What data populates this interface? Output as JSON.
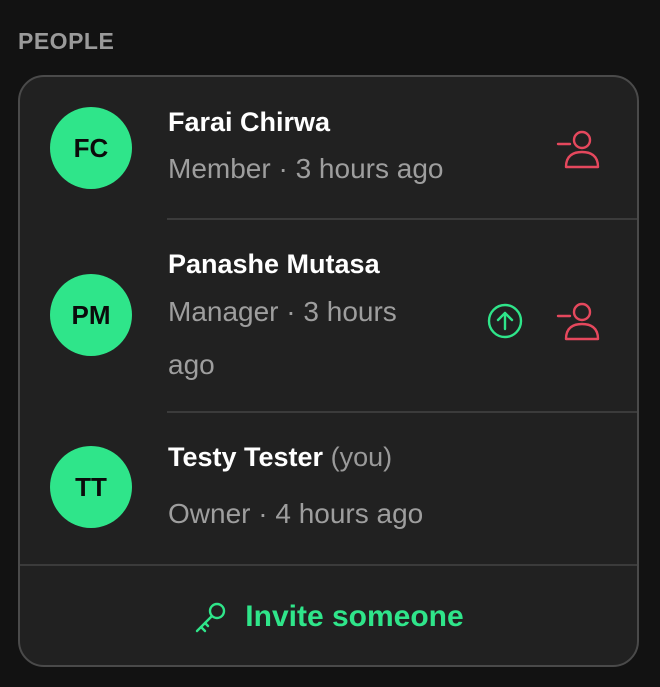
{
  "section": {
    "title": "PEOPLE"
  },
  "people": [
    {
      "initials": "FC",
      "name": "Farai Chirwa",
      "suffix": "",
      "meta": "Member · 3 hours ago"
    },
    {
      "initials": "PM",
      "name": "Panashe Mutasa",
      "suffix": "",
      "meta_line1": "Manager · 3 hours",
      "meta_line2": "ago"
    },
    {
      "initials": "TT",
      "name": "Testy Tester",
      "suffix": "(you)",
      "meta": "Owner · 4 hours ago"
    }
  ],
  "invite": {
    "label": "Invite someone"
  },
  "icons": {
    "remove": "remove-user-icon",
    "promote": "arrow-up-circle-icon",
    "invite": "key-icon"
  },
  "colors": {
    "accent": "#2fe58a",
    "danger": "#e5485d",
    "card": "#212121",
    "background": "#121212"
  }
}
